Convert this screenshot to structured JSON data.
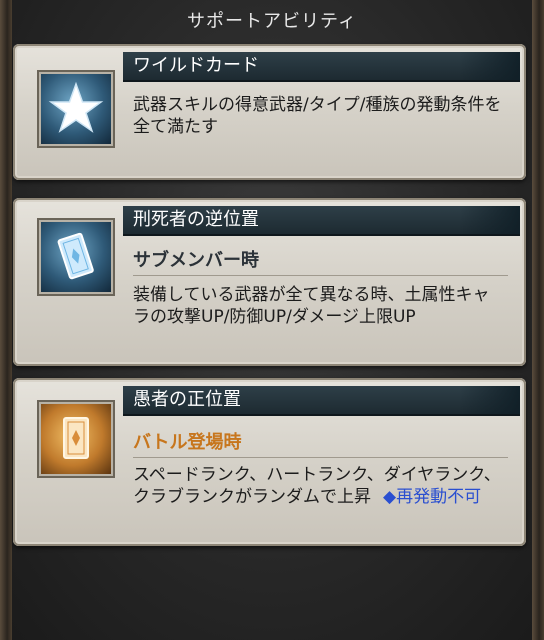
{
  "header": {
    "title": "サポートアビリティ"
  },
  "abilities": [
    {
      "name": "ワイルドカード",
      "icon": "star-icon",
      "condition": "",
      "description": "武器スキルの得意武器/タイプ/種族の発動条件を全て満たす"
    },
    {
      "name": "刑死者の逆位置",
      "icon": "reversed-tarot-card-icon",
      "condition": "サブメンバー時",
      "description": "装備している武器が全て異なる時、土属性キャラの攻撃UP/防御UP/ダメージ上限UP"
    },
    {
      "name": "愚者の正位置",
      "icon": "upright-tarot-card-icon",
      "condition": "バトル登場時",
      "description": "スペードランク、ハートランク、ダイヤランク、クラブランクがランダムで上昇",
      "note": "◆再発動不可"
    }
  ],
  "colors": {
    "condition_blue": "#2b3238",
    "condition_gold": "#c7761d",
    "note": "#2a4fd0",
    "title_bar": "#1d2a31"
  }
}
